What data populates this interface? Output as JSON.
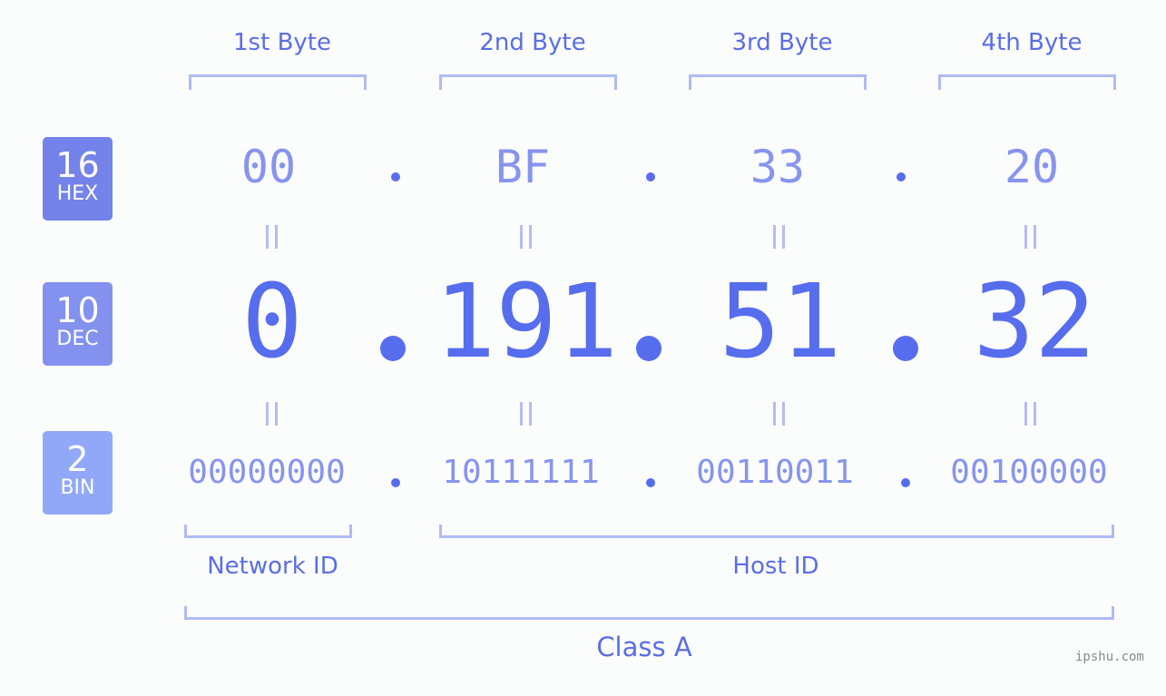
{
  "bytes": {
    "labels": [
      "1st Byte",
      "2nd Byte",
      "3rd Byte",
      "4th Byte"
    ],
    "hex": [
      "00",
      "BF",
      "33",
      "20"
    ],
    "dec": [
      "0",
      "191",
      "51",
      "32"
    ],
    "bin": [
      "00000000",
      "10111111",
      "00110011",
      "00100000"
    ]
  },
  "badges": {
    "hex": {
      "number": "16",
      "label": "HEX",
      "color": "#7383ea"
    },
    "dec": {
      "number": "10",
      "label": "DEC",
      "color": "#8392ef"
    },
    "bin": {
      "number": "2",
      "label": "BIN",
      "color": "#91a8f8"
    }
  },
  "sections": {
    "network": "Network ID",
    "host": "Host ID",
    "class": "Class A"
  },
  "colors": {
    "accent": "#566ded",
    "light": "#8794ee",
    "bracket": "#b0bbf4"
  },
  "watermark": "ipshu.com"
}
